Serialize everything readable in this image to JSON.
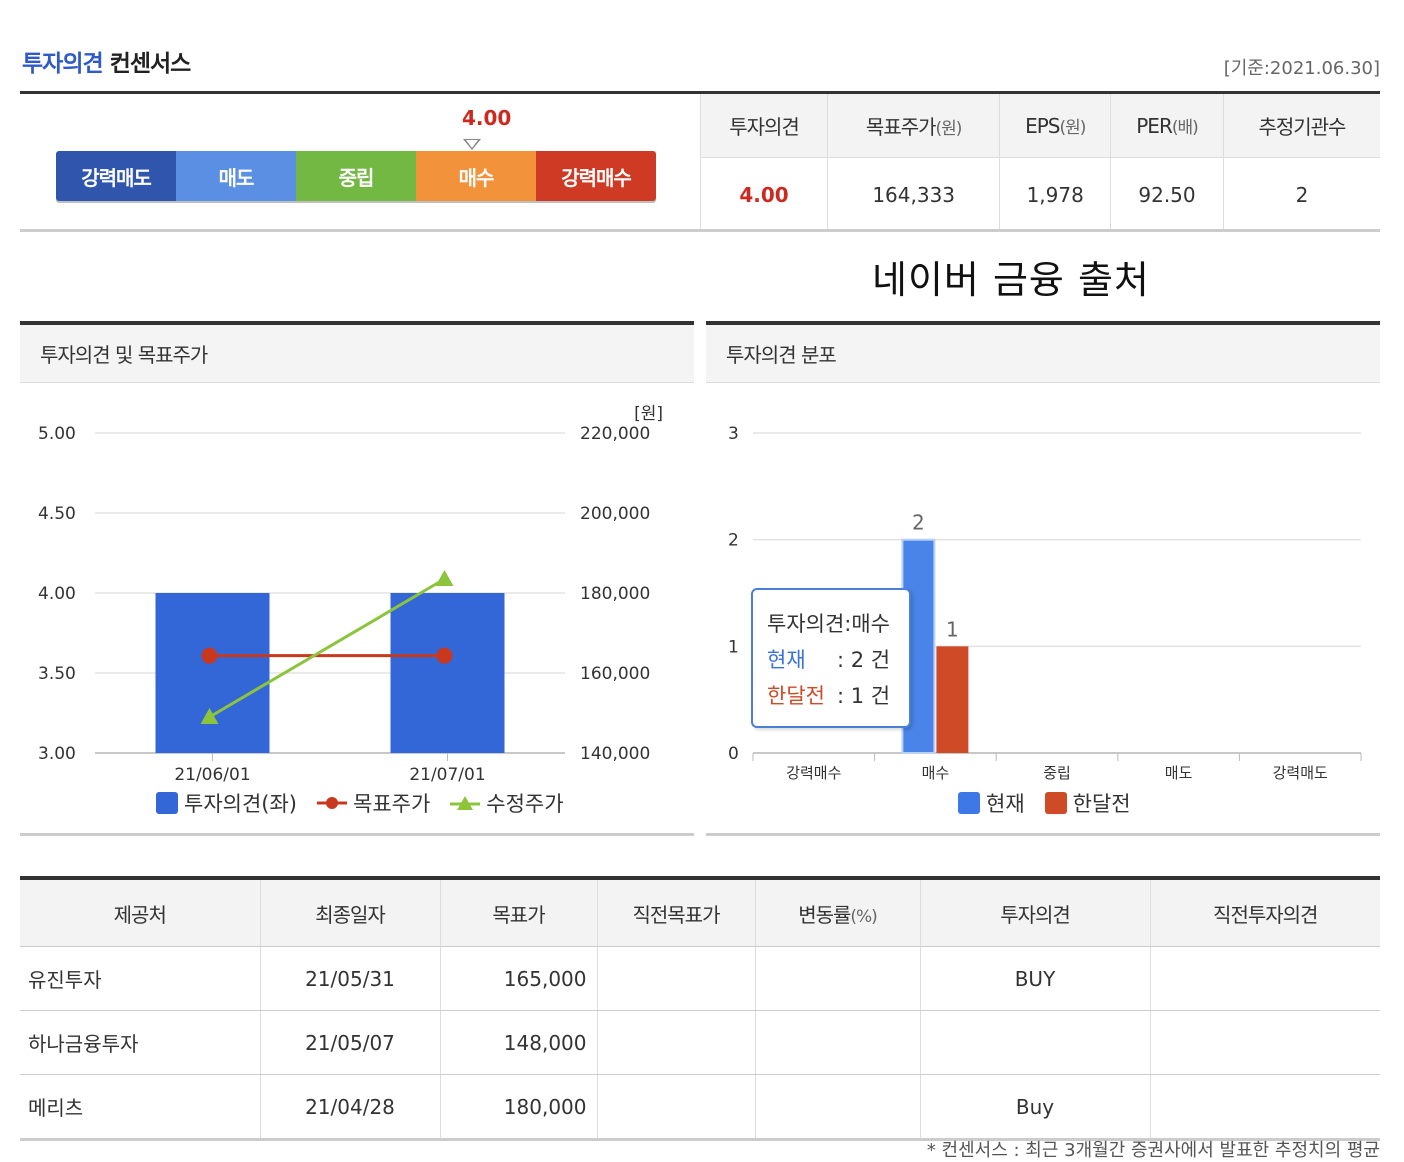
{
  "header": {
    "title_blue": "투자의견",
    "title_black": "컨센서스",
    "basis": "[기준:2021.06.30]"
  },
  "gauge": {
    "value": "4.00",
    "segments": [
      {
        "label": "강력매도",
        "color": "#2f55ad"
      },
      {
        "label": "매도",
        "color": "#5b8fe3"
      },
      {
        "label": "중립",
        "color": "#73b843"
      },
      {
        "label": "매수",
        "color": "#f2923a"
      },
      {
        "label": "강력매수",
        "color": "#cf3a25"
      }
    ]
  },
  "summary": {
    "headers": [
      {
        "main": "투자의견",
        "unit": ""
      },
      {
        "main": "목표주가",
        "unit": "(원)"
      },
      {
        "main": "EPS",
        "unit": "(원)"
      },
      {
        "main": "PER",
        "unit": "(배)"
      },
      {
        "main": "추정기관수",
        "unit": ""
      }
    ],
    "values": [
      "4.00",
      "164,333",
      "1,978",
      "92.50",
      "2"
    ]
  },
  "source_note": "네이버 금융 출처",
  "panel_left": {
    "title": "투자의견 및 목표주가",
    "unit_label": "[원]",
    "legend": [
      "투자의견(좌)",
      "목표주가",
      "수정주가"
    ]
  },
  "panel_right": {
    "title": "투자의견 분포",
    "legend": [
      "현재",
      "한달전"
    ],
    "tooltip": {
      "title": "투자의견:매수",
      "current_label": "현재",
      "current_value": ": 2 건",
      "prev_label": "한달전",
      "prev_value": ": 1 건"
    }
  },
  "chart_data": [
    {
      "type": "bar",
      "title": "투자의견 및 목표주가",
      "categories": [
        "21/06/01",
        "21/07/01"
      ],
      "y_left_ticks": [
        "5.00",
        "4.50",
        "4.00",
        "3.50",
        "3.00"
      ],
      "y_right_ticks": [
        "220,000",
        "200,000",
        "180,000",
        "160,000",
        "140,000"
      ],
      "ylim_left": [
        3.0,
        5.0
      ],
      "ylim_right": [
        140000,
        220000
      ],
      "series": [
        {
          "name": "투자의견(좌)",
          "type": "bar",
          "axis": "left",
          "values": [
            4.0,
            4.0
          ],
          "color": "#3366d6"
        },
        {
          "name": "목표주가",
          "type": "line",
          "axis": "right",
          "values": [
            164333,
            164333
          ],
          "color": "#c8381e"
        },
        {
          "name": "수정주가",
          "type": "line",
          "axis": "right",
          "values": [
            149000,
            183500
          ],
          "color": "#8cc43c"
        }
      ]
    },
    {
      "type": "bar",
      "title": "투자의견 분포",
      "categories": [
        "강력매수",
        "매수",
        "중립",
        "매도",
        "강력매도"
      ],
      "ylim": [
        0,
        3
      ],
      "y_ticks": [
        "3",
        "2",
        "1",
        "0"
      ],
      "series": [
        {
          "name": "현재",
          "values": [
            0,
            2,
            0,
            0,
            0
          ],
          "color": "#4a84e8"
        },
        {
          "name": "한달전",
          "values": [
            0,
            1,
            0,
            0,
            0
          ],
          "color": "#cf4a26"
        }
      ]
    }
  ],
  "table": {
    "headers": [
      {
        "main": "제공처",
        "unit": ""
      },
      {
        "main": "최종일자",
        "unit": ""
      },
      {
        "main": "목표가",
        "unit": ""
      },
      {
        "main": "직전목표가",
        "unit": ""
      },
      {
        "main": "변동률",
        "unit": "(%)"
      },
      {
        "main": "투자의견",
        "unit": ""
      },
      {
        "main": "직전투자의견",
        "unit": ""
      }
    ],
    "rows": [
      [
        "유진투자",
        "21/05/31",
        "165,000",
        "",
        "",
        "BUY",
        ""
      ],
      [
        "하나금융투자",
        "21/05/07",
        "148,000",
        "",
        "",
        "",
        ""
      ],
      [
        "메리츠",
        "21/04/28",
        "180,000",
        "",
        "",
        "Buy",
        ""
      ]
    ]
  },
  "footnote": "* 컨센서스 : 최근 3개월간 증권사에서 발표한 추정치의 평균"
}
